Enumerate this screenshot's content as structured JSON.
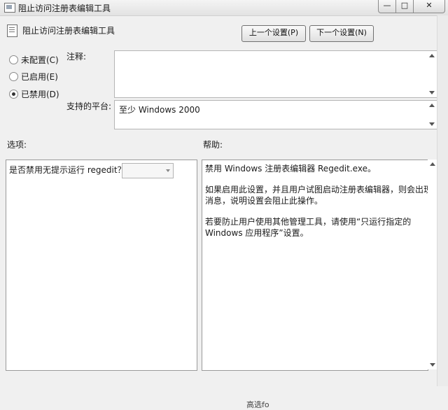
{
  "window": {
    "title": "阻止访问注册表编辑工具",
    "min_glyph": "—",
    "max_glyph": "□",
    "close_glyph": "✕"
  },
  "header": {
    "setting_title": "阻止访问注册表编辑工具",
    "prev_button": "上一个设置(P)",
    "next_button": "下一个设置(N)"
  },
  "state": {
    "options": [
      {
        "label": "未配置(C)",
        "checked": false
      },
      {
        "label": "已启用(E)",
        "checked": false
      },
      {
        "label": "已禁用(D)",
        "checked": true
      }
    ]
  },
  "comment": {
    "label": "注释:",
    "value": ""
  },
  "platform": {
    "label": "支持的平台:",
    "value": "至少 Windows 2000"
  },
  "options_section": {
    "label": "选项:",
    "prompt": "是否禁用无提示运行 regedit？",
    "combo_value": ""
  },
  "help_section": {
    "label": "帮助:",
    "lines": [
      "禁用 Windows 注册表编辑器 Regedit.exe。",
      "如果启用此设置，并且用户试图启动注册表编辑器，则会出现一条",
      "消息，说明设置会阻止此操作。",
      "若要防止用户使用其他管理工具，请使用“只运行指定的",
      "Windows 应用程序”设置。"
    ]
  },
  "footer": {
    "partial_text": "高选fo"
  }
}
